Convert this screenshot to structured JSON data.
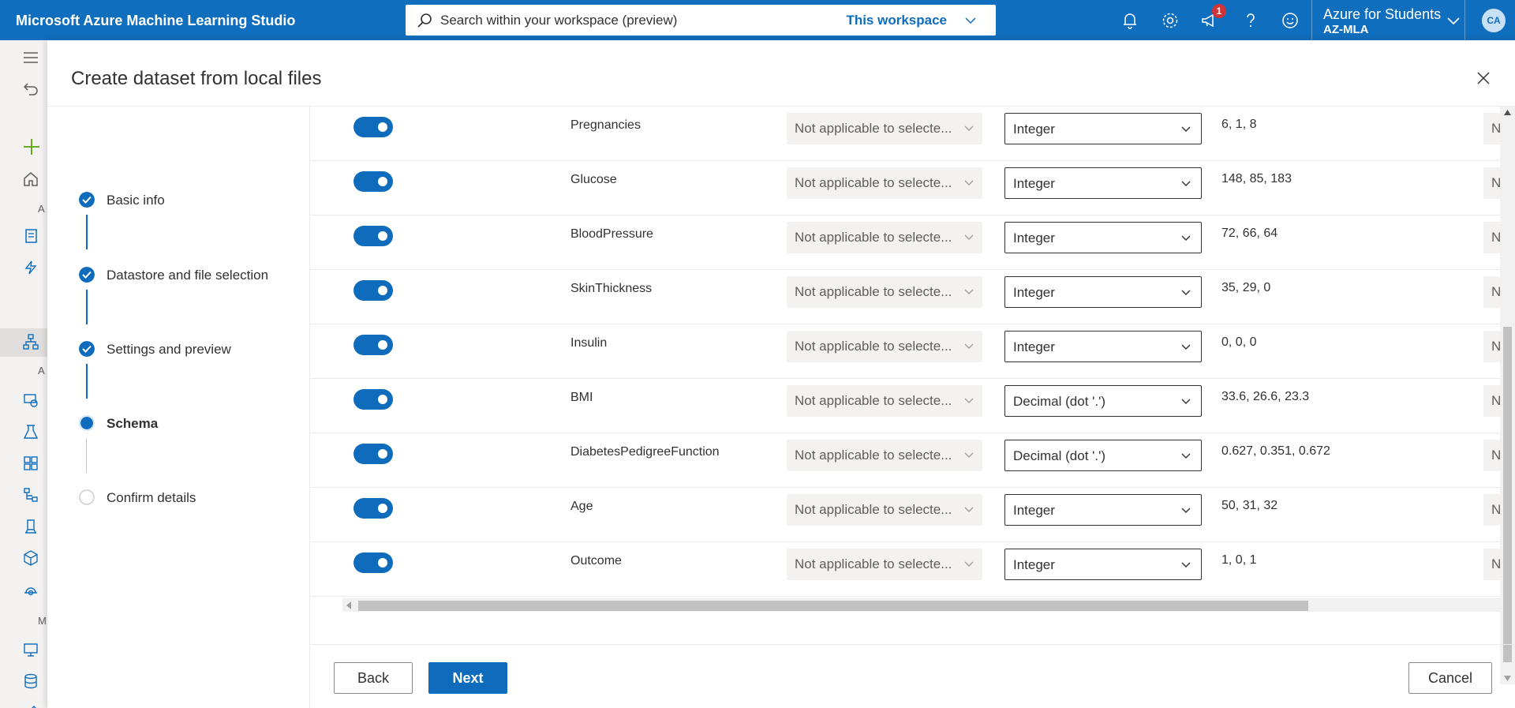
{
  "app": {
    "title": "Microsoft Azure Machine Learning Studio",
    "search_placeholder": "Search within your workspace (preview)",
    "search_scope": "This workspace",
    "notification_count": "1",
    "account_name": "Azure for Students",
    "account_sub": "AZ-MLA",
    "avatar_initials": "CA"
  },
  "rail": {
    "labels": [
      "A",
      "A",
      "M"
    ]
  },
  "dialog": {
    "title": "Create dataset from local files"
  },
  "steps": [
    {
      "label": "Basic info",
      "state": "done"
    },
    {
      "label": "Datastore and file selection",
      "state": "done"
    },
    {
      "label": "Settings and preview",
      "state": "done"
    },
    {
      "label": "Schema",
      "state": "current"
    },
    {
      "label": "Confirm details",
      "state": "todo"
    }
  ],
  "schema": {
    "format_placeholder": "Not applicable to selecte...",
    "trailing_cell": "Not",
    "rows": [
      {
        "name": "Pregnancies",
        "type": "Integer",
        "preview": "6, 1, 8",
        "included": true
      },
      {
        "name": "Glucose",
        "type": "Integer",
        "preview": "148, 85, 183",
        "included": true
      },
      {
        "name": "BloodPressure",
        "type": "Integer",
        "preview": "72, 66, 64",
        "included": true
      },
      {
        "name": "SkinThickness",
        "type": "Integer",
        "preview": "35, 29, 0",
        "included": true
      },
      {
        "name": "Insulin",
        "type": "Integer",
        "preview": "0, 0, 0",
        "included": true
      },
      {
        "name": "BMI",
        "type": "Decimal (dot '.')",
        "preview": "33.6, 26.6, 23.3",
        "included": true
      },
      {
        "name": "DiabetesPedigreeFunction",
        "type": "Decimal (dot '.')",
        "preview": "0.627, 0.351, 0.672",
        "included": true
      },
      {
        "name": "Age",
        "type": "Integer",
        "preview": "50, 31, 32",
        "included": true
      },
      {
        "name": "Outcome",
        "type": "Integer",
        "preview": "1, 0, 1",
        "included": true
      }
    ]
  },
  "footer": {
    "back_label": "Back",
    "next_label": "Next",
    "cancel_label": "Cancel"
  },
  "colors": {
    "accent": "#0f6cbd",
    "topbar": "#106ebe"
  }
}
